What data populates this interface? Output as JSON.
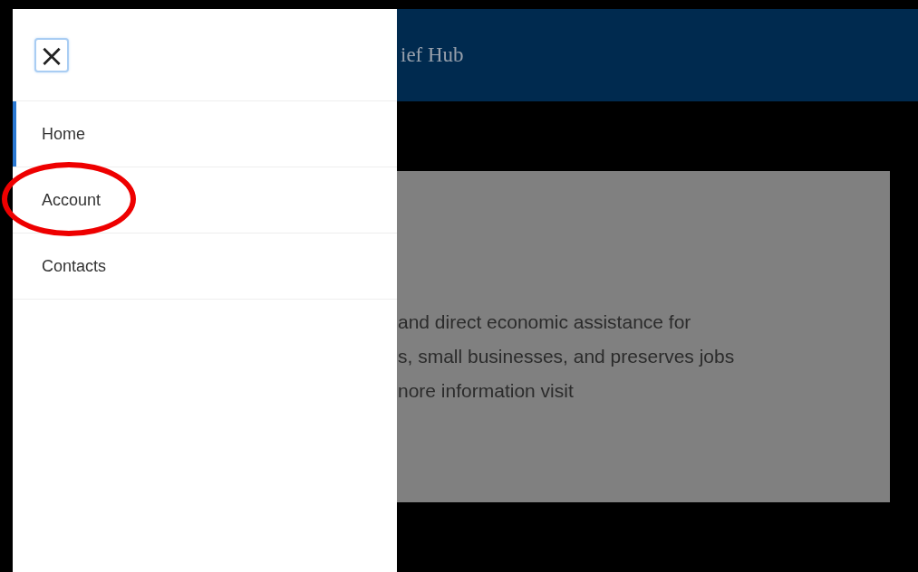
{
  "header": {
    "title": "ief Hub"
  },
  "nav_menu": {
    "close_button": {
      "label": "×",
      "focused": true
    },
    "items": [
      {
        "label": "Home",
        "selected": true,
        "circled": false
      },
      {
        "label": "Account",
        "selected": false,
        "circled": true
      },
      {
        "label": "Contacts",
        "selected": false,
        "circled": false
      }
    ]
  },
  "card": {
    "text": "and direct economic assistance for\ns, small businesses, and preserves jobs\nnore information visit"
  },
  "annotation": {
    "kind": "ellipse",
    "color": "#ee0000"
  }
}
